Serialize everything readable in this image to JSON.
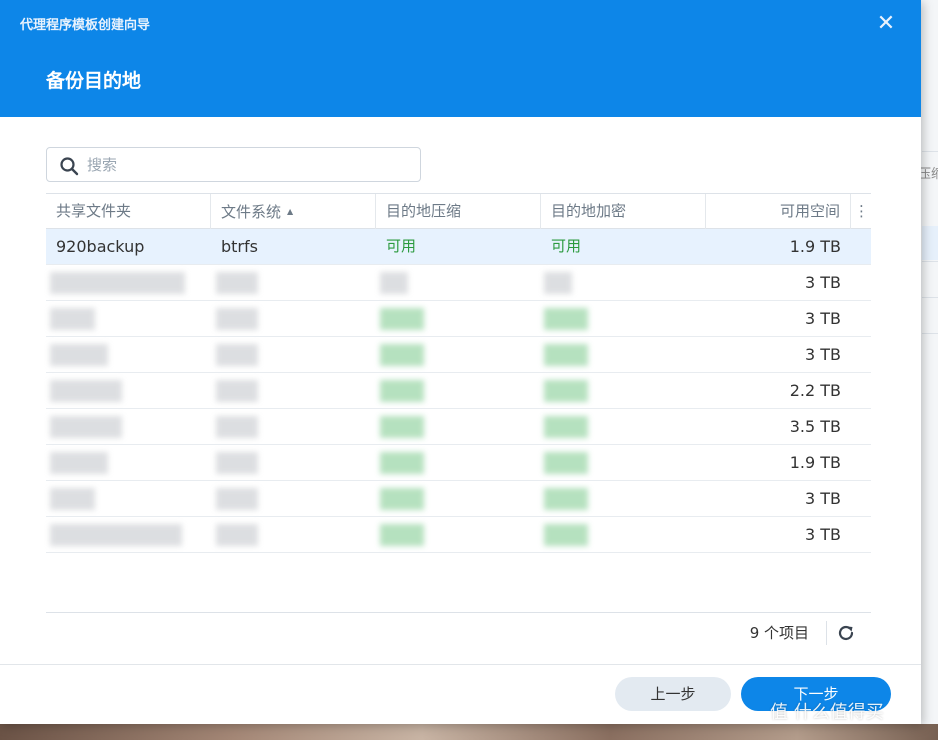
{
  "dialog": {
    "title": "代理程序模板创建向导",
    "close_symbol": "✕",
    "step_title": "备份目的地"
  },
  "search": {
    "placeholder": "搜索",
    "value": ""
  },
  "table": {
    "columns": [
      "共享文件夹",
      "文件系统",
      "目的地压缩",
      "目的地加密",
      "可用空间"
    ],
    "sort_indicator": "▲",
    "menu_symbol": "⋮",
    "rows": [
      {
        "name": "920backup",
        "fs": "btrfs",
        "compression": "可用",
        "encryption": "可用",
        "space": "1.9 TB"
      },
      {
        "space": "3 TB"
      },
      {
        "space": "3 TB"
      },
      {
        "space": "3 TB"
      },
      {
        "space": "2.2 TB"
      },
      {
        "space": "3.5 TB"
      },
      {
        "space": "1.9 TB"
      },
      {
        "space": "3 TB"
      },
      {
        "space": "3 TB"
      }
    ],
    "item_count": "9 个项目"
  },
  "buttons": {
    "prev": "上一步",
    "next": "下一步"
  },
  "background_fragment": "压缩",
  "watermark": "值 什么值得买",
  "colors": {
    "accent": "#0d86e8",
    "available_green": "#2b9a3e",
    "selected_row": "#e7f2fe"
  },
  "icons": [
    "close-icon",
    "search-icon",
    "sort-asc-icon",
    "column-menu-icon",
    "refresh-icon"
  ]
}
